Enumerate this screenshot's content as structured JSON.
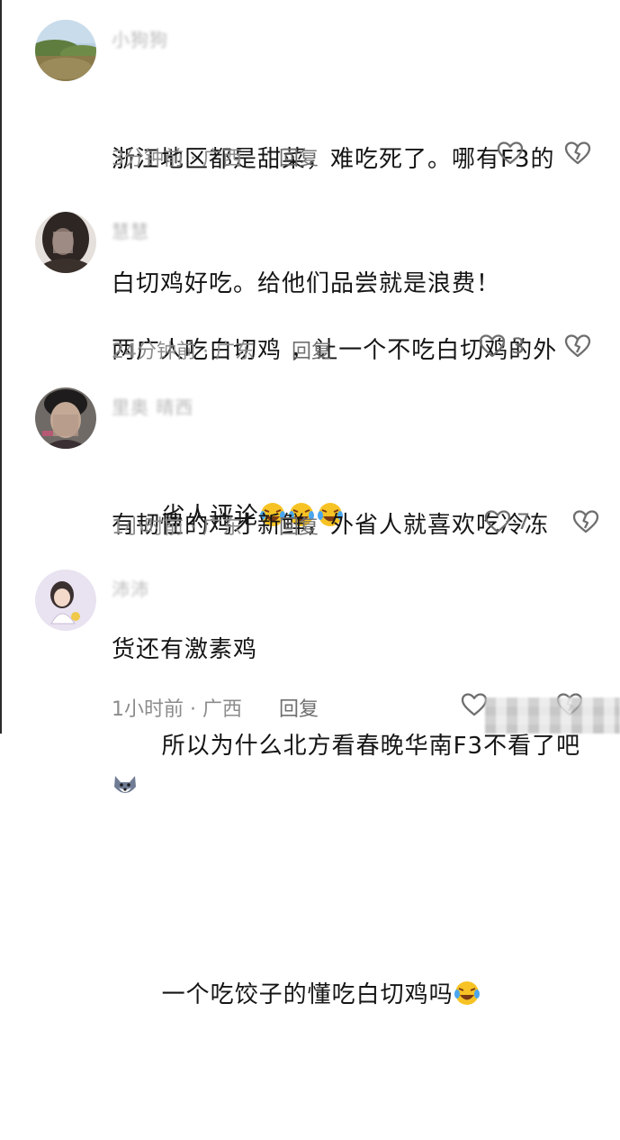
{
  "comments": [
    {
      "username": "小狗狗",
      "lines": [
        "浙江地区都是甜菜，难吃死了。哪有F3的",
        "白切鸡好吃。给他们品尝就是浪费！"
      ],
      "time": "3分钟前",
      "location": "广西",
      "reply_label": "回复",
      "like_count": ""
    },
    {
      "username": "慧慧",
      "lines": [
        "两广人吃白切鸡 ，让一个不吃白切鸡的外",
        "省人评论"
      ],
      "time": "24分钟前",
      "location": "广东",
      "reply_label": "回复",
      "like_count": "3"
    },
    {
      "username": "里奥 晴西",
      "lines": [
        "有韧性的鸡才新鲜，外省人就喜欢吃冷冻",
        "货还有激素鸡"
      ],
      "time": "1小时前",
      "location": "广东",
      "reply_label": "回复",
      "like_count": "7"
    },
    {
      "username": "沛沛",
      "lines": [
        "所以为什么北方看春晚华南F3不看了吧",
        "一个吃饺子的懂吃白切鸡吗"
      ],
      "time": "1小时前",
      "location": "广西",
      "reply_label": "回复",
      "like_count": ""
    }
  ],
  "meta_separator": "·",
  "icons": {
    "like": "heart-outline-icon",
    "dislike": "broken-heart-icon",
    "emoji_laugh_cry": "laughing-crying-emoji-icon",
    "emoji_wolf": "wolf-face-emoji-icon"
  },
  "colors": {
    "text": "#151515",
    "meta": "#8c8c8c",
    "icon": "#6e6e6e"
  }
}
